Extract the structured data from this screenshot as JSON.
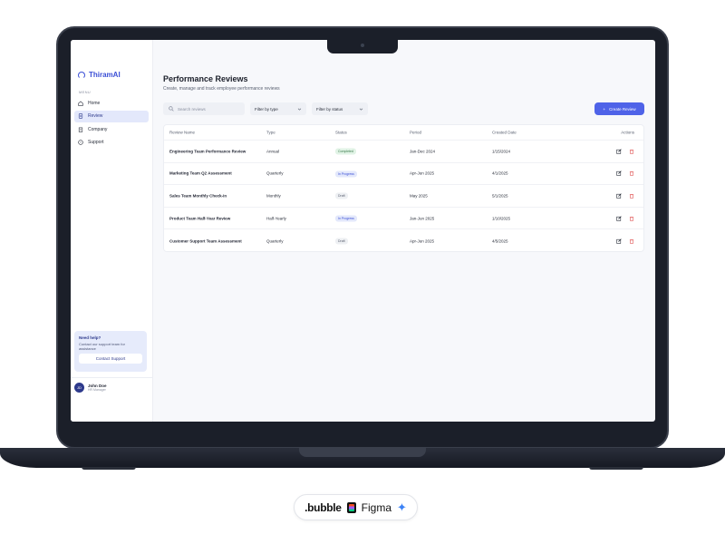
{
  "app": {
    "logo_text": "ThiramAI",
    "menu_label": "MENU"
  },
  "sidebar": {
    "items": [
      {
        "label": "Home",
        "icon": "home-icon",
        "active": false
      },
      {
        "label": "Review",
        "icon": "document-icon",
        "active": true
      },
      {
        "label": "Company",
        "icon": "building-icon",
        "active": false
      },
      {
        "label": "Support",
        "icon": "help-circle-icon",
        "active": false
      }
    ],
    "help": {
      "title": "Need help?",
      "text": "Contact our support team for assistance",
      "button": "Contact Support"
    },
    "user": {
      "initials": "JD",
      "name": "John Doe",
      "role": "HR Manager"
    }
  },
  "main": {
    "title": "Performance Reviews",
    "subtitle": "Create, manage and track employee performance reviews",
    "search_placeholder": "Search reviews",
    "filter_type": "Filter by type",
    "filter_status": "Filter by status",
    "create_button": "Create Review",
    "table": {
      "headers": [
        "Review Name",
        "Type",
        "Status",
        "Period",
        "Created Date",
        "Actions"
      ],
      "rows": [
        {
          "name": "Engineering Team Performance Review",
          "type": "Annual",
          "status": "Completed",
          "period": "Jan-Dec 2024",
          "created": "1/15/2024"
        },
        {
          "name": "Marketing Team Q2 Assessment",
          "type": "Quarterly",
          "status": "In Progress",
          "period": "Apr-Jun 2025",
          "created": "4/1/2025"
        },
        {
          "name": "Sales Team Monthly Check-in",
          "type": "Monthly",
          "status": "Draft",
          "period": "May 2025",
          "created": "5/1/2025"
        },
        {
          "name": "Product Team Half-Year Review",
          "type": "Half-Yearly",
          "status": "In Progress",
          "period": "Jan-Jun 2025",
          "created": "1/10/2025"
        },
        {
          "name": "Customer Support Team Assessment",
          "type": "Quarterly",
          "status": "Draft",
          "period": "Apr-Jun 2025",
          "created": "4/5/2025"
        }
      ]
    }
  },
  "footer_badge": {
    "bubble": ".bubble",
    "figma": "Figma"
  },
  "colors": {
    "accent": "#4f63e8",
    "brand": "#3b4fd6",
    "delete": "#e05555"
  }
}
